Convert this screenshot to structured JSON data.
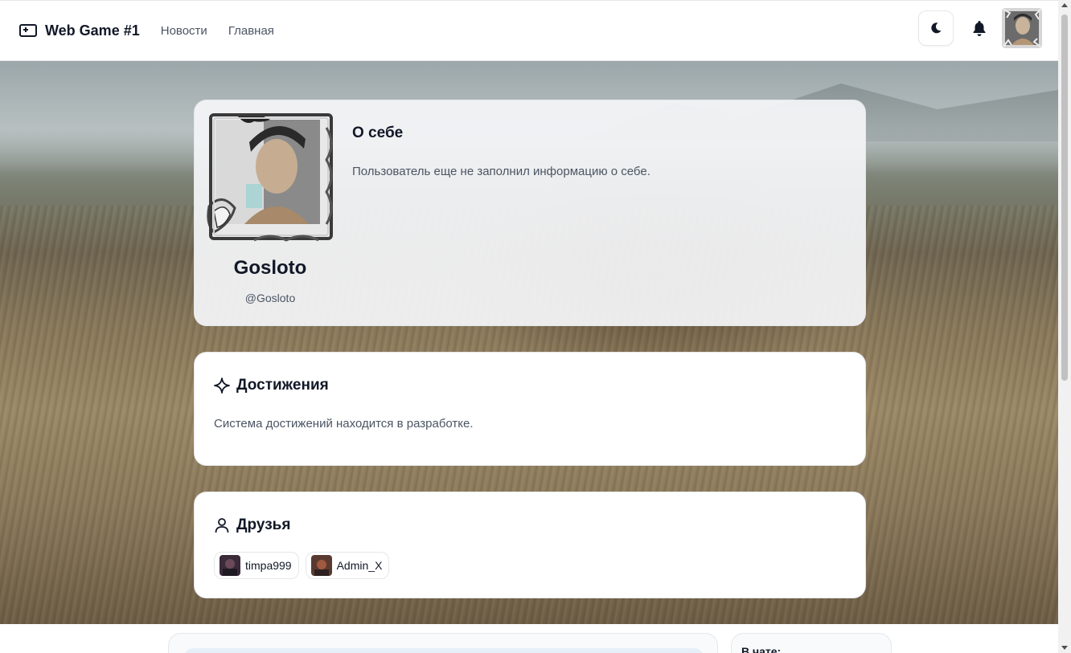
{
  "header": {
    "brand": "Web Game #1",
    "nav": [
      {
        "label": "Новости"
      },
      {
        "label": "Главная"
      }
    ],
    "icons": {
      "brand": "ticket-icon",
      "theme": "moon-icon",
      "notifications": "bell-icon"
    }
  },
  "profile": {
    "name": "Gosloto",
    "handle": "@Gosloto",
    "about_title": "О себе",
    "about_text": "Пользователь еще не заполнил информацию о себе."
  },
  "achievements": {
    "title": "Достижения",
    "text": "Система достижений находится в разработке.",
    "icon": "sparkle-icon"
  },
  "friends": {
    "title": "Друзья",
    "icon": "user-icon",
    "items": [
      {
        "name": "timpa999"
      },
      {
        "name": "Admin_X"
      }
    ]
  },
  "chat": {
    "online_label": "В чате:"
  },
  "colors": {
    "accent": "#111827",
    "muted": "#4b5563",
    "border": "#e5e7eb"
  }
}
